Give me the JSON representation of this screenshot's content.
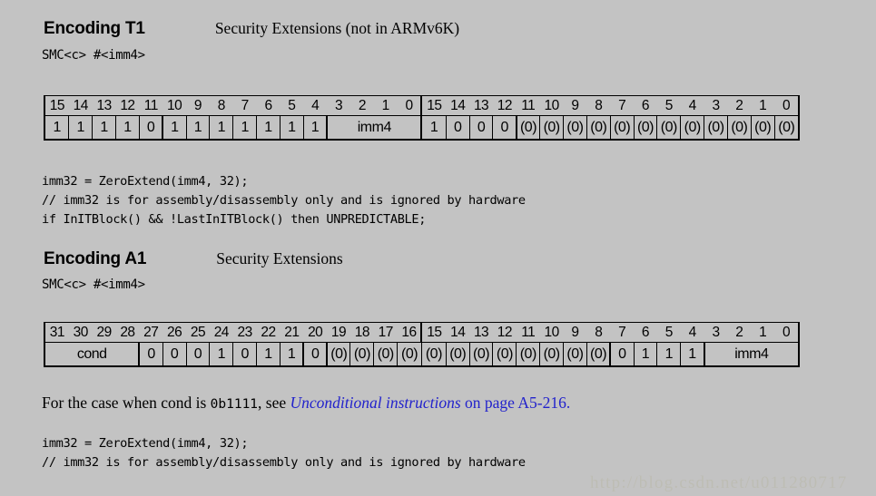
{
  "colors": {
    "page_background": "#c3c3c3",
    "text": "#000000",
    "link": "#2222cc",
    "watermark": "#bdbcb2"
  },
  "encodings": [
    {
      "title": "Encoding T1",
      "note": "Security Extensions (not in ARMv6K)",
      "syntax": "SMC<c> #<imm4>",
      "table": {
        "bit_numbers": [
          "15",
          "14",
          "13",
          "12",
          "11",
          "10",
          "9",
          "8",
          "7",
          "6",
          "5",
          "4",
          "3",
          "2",
          "1",
          "0",
          "15",
          "14",
          "13",
          "12",
          "11",
          "10",
          "9",
          "8",
          "7",
          "6",
          "5",
          "4",
          "3",
          "2",
          "1",
          "0"
        ],
        "fields": [
          {
            "label": "1",
            "span": 1,
            "half_start": true
          },
          {
            "label": "1",
            "span": 1
          },
          {
            "label": "1",
            "span": 1
          },
          {
            "label": "1",
            "span": 1
          },
          {
            "label": "0",
            "span": 1
          },
          {
            "label": "1",
            "span": 1,
            "group_start": true
          },
          {
            "label": "1",
            "span": 1
          },
          {
            "label": "1",
            "span": 1
          },
          {
            "label": "1",
            "span": 1
          },
          {
            "label": "1",
            "span": 1
          },
          {
            "label": "1",
            "span": 1
          },
          {
            "label": "1",
            "span": 1
          },
          {
            "label": "imm4",
            "span": 4,
            "group_start": true
          },
          {
            "label": "1",
            "span": 1,
            "half_start": true
          },
          {
            "label": "0",
            "span": 1
          },
          {
            "label": "0",
            "span": 1
          },
          {
            "label": "0",
            "span": 1
          },
          {
            "label": "(0)",
            "span": 1,
            "group_start": true
          },
          {
            "label": "(0)",
            "span": 1
          },
          {
            "label": "(0)",
            "span": 1
          },
          {
            "label": "(0)",
            "span": 1
          },
          {
            "label": "(0)",
            "span": 1
          },
          {
            "label": "(0)",
            "span": 1
          },
          {
            "label": "(0)",
            "span": 1
          },
          {
            "label": "(0)",
            "span": 1
          },
          {
            "label": "(0)",
            "span": 1
          },
          {
            "label": "(0)",
            "span": 1
          },
          {
            "label": "(0)",
            "span": 1
          },
          {
            "label": "(0)",
            "span": 1
          }
        ]
      },
      "pseudocode": "imm32 = ZeroExtend(imm4, 32);\n// imm32 is for assembly/disassembly only and is ignored by hardware\nif InITBlock() && !LastInITBlock() then UNPREDICTABLE;"
    },
    {
      "title": "Encoding A1",
      "note": "Security Extensions",
      "syntax": "SMC<c> #<imm4>",
      "table": {
        "bit_numbers": [
          "31",
          "30",
          "29",
          "28",
          "27",
          "26",
          "25",
          "24",
          "23",
          "22",
          "21",
          "20",
          "19",
          "18",
          "17",
          "16",
          "15",
          "14",
          "13",
          "12",
          "11",
          "10",
          "9",
          "8",
          "7",
          "6",
          "5",
          "4",
          "3",
          "2",
          "1",
          "0"
        ],
        "fields": [
          {
            "label": "cond",
            "span": 4
          },
          {
            "label": "0",
            "span": 1,
            "group_start": true
          },
          {
            "label": "0",
            "span": 1
          },
          {
            "label": "0",
            "span": 1
          },
          {
            "label": "1",
            "span": 1
          },
          {
            "label": "0",
            "span": 1
          },
          {
            "label": "1",
            "span": 1
          },
          {
            "label": "1",
            "span": 1
          },
          {
            "label": "0",
            "span": 1,
            "group_start": true
          },
          {
            "label": "(0)",
            "span": 1,
            "group_start": true
          },
          {
            "label": "(0)",
            "span": 1
          },
          {
            "label": "(0)",
            "span": 1
          },
          {
            "label": "(0)",
            "span": 1
          },
          {
            "label": "(0)",
            "span": 1
          },
          {
            "label": "(0)",
            "span": 1
          },
          {
            "label": "(0)",
            "span": 1
          },
          {
            "label": "(0)",
            "span": 1
          },
          {
            "label": "(0)",
            "span": 1
          },
          {
            "label": "(0)",
            "span": 1
          },
          {
            "label": "(0)",
            "span": 1
          },
          {
            "label": "(0)",
            "span": 1
          },
          {
            "label": "0",
            "span": 1,
            "group_start": true
          },
          {
            "label": "1",
            "span": 1
          },
          {
            "label": "1",
            "span": 1
          },
          {
            "label": "1",
            "span": 1
          },
          {
            "label": "imm4",
            "span": 4,
            "group_start": true
          }
        ]
      },
      "pseudocode": "imm32 = ZeroExtend(imm4, 32);\n// imm32 is for assembly/disassembly only and is ignored by hardware"
    }
  ],
  "cond_note": {
    "lead": "For the case when cond is ",
    "code": "0b1111",
    "middle": ", see ",
    "link_text": "Unconditional instructions",
    "link_tail": " on page A5-216."
  },
  "watermark": {
    "text": "http://blog.csdn.net/u011280717"
  }
}
